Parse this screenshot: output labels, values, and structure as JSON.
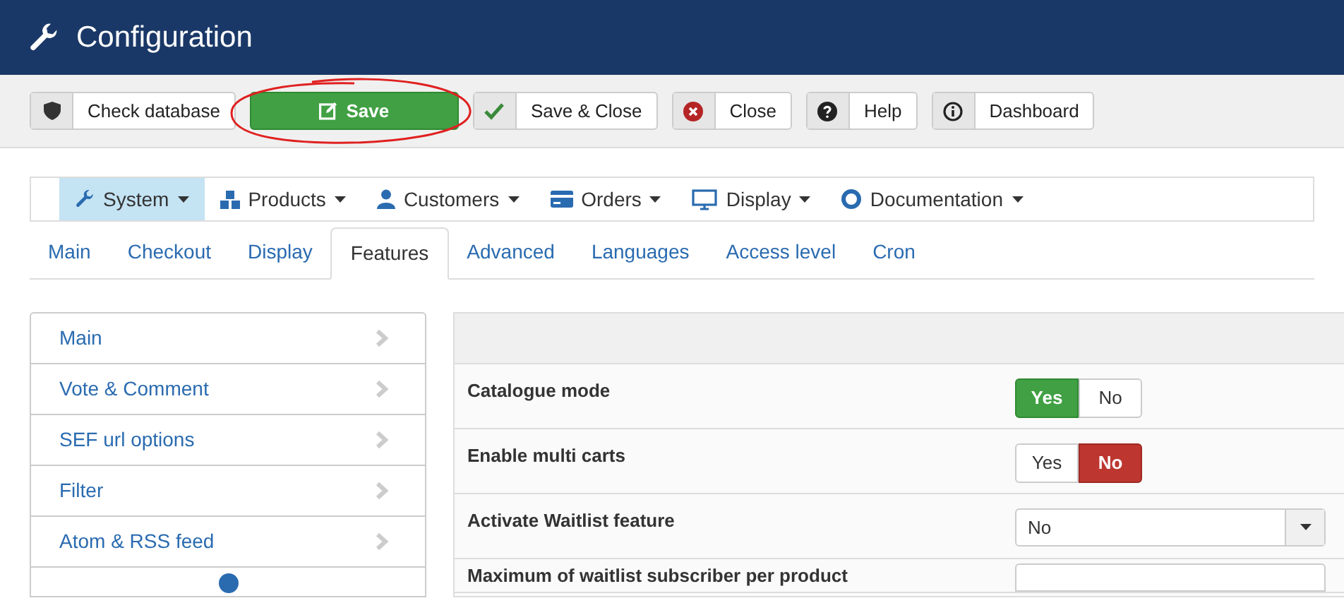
{
  "header": {
    "title": "Configuration"
  },
  "toolbar": [
    {
      "label": "Check database",
      "kind": "default"
    },
    {
      "label": "Save",
      "kind": "primary"
    },
    {
      "label": "Save & Close",
      "kind": "default"
    },
    {
      "label": "Close",
      "kind": "default"
    },
    {
      "label": "Help",
      "kind": "default"
    },
    {
      "label": "Dashboard",
      "kind": "default"
    }
  ],
  "menu": [
    {
      "label": "System",
      "selected": true
    },
    {
      "label": "Products",
      "selected": false
    },
    {
      "label": "Customers",
      "selected": false
    },
    {
      "label": "Orders",
      "selected": false
    },
    {
      "label": "Display",
      "selected": false
    },
    {
      "label": "Documentation",
      "selected": false
    }
  ],
  "tabs": [
    {
      "label": "Main",
      "selected": false
    },
    {
      "label": "Checkout",
      "selected": false
    },
    {
      "label": "Display",
      "selected": false
    },
    {
      "label": "Features",
      "selected": true
    },
    {
      "label": "Advanced",
      "selected": false
    },
    {
      "label": "Languages",
      "selected": false
    },
    {
      "label": "Access level",
      "selected": false
    },
    {
      "label": "Cron",
      "selected": false
    }
  ],
  "sidebar": {
    "items": [
      "Main",
      "Vote & Comment",
      "SEF url options",
      "Filter",
      "Atom & RSS feed"
    ]
  },
  "settings": [
    {
      "label": "Catalogue mode",
      "kind": "toggle",
      "options": [
        {
          "label": "Yes",
          "kind": "yes",
          "selected": true
        },
        {
          "label": "No",
          "kind": "no",
          "selected": false
        }
      ]
    },
    {
      "label": "Enable multi carts",
      "kind": "toggle",
      "options": [
        {
          "label": "Yes",
          "kind": "yes",
          "selected": false
        },
        {
          "label": "No",
          "kind": "no",
          "selected": true
        }
      ]
    },
    {
      "label": "Activate Waitlist feature",
      "kind": "select",
      "value": "No"
    },
    {
      "label": "Maximum of waitlist subscriber per product",
      "kind": "input"
    }
  ]
}
